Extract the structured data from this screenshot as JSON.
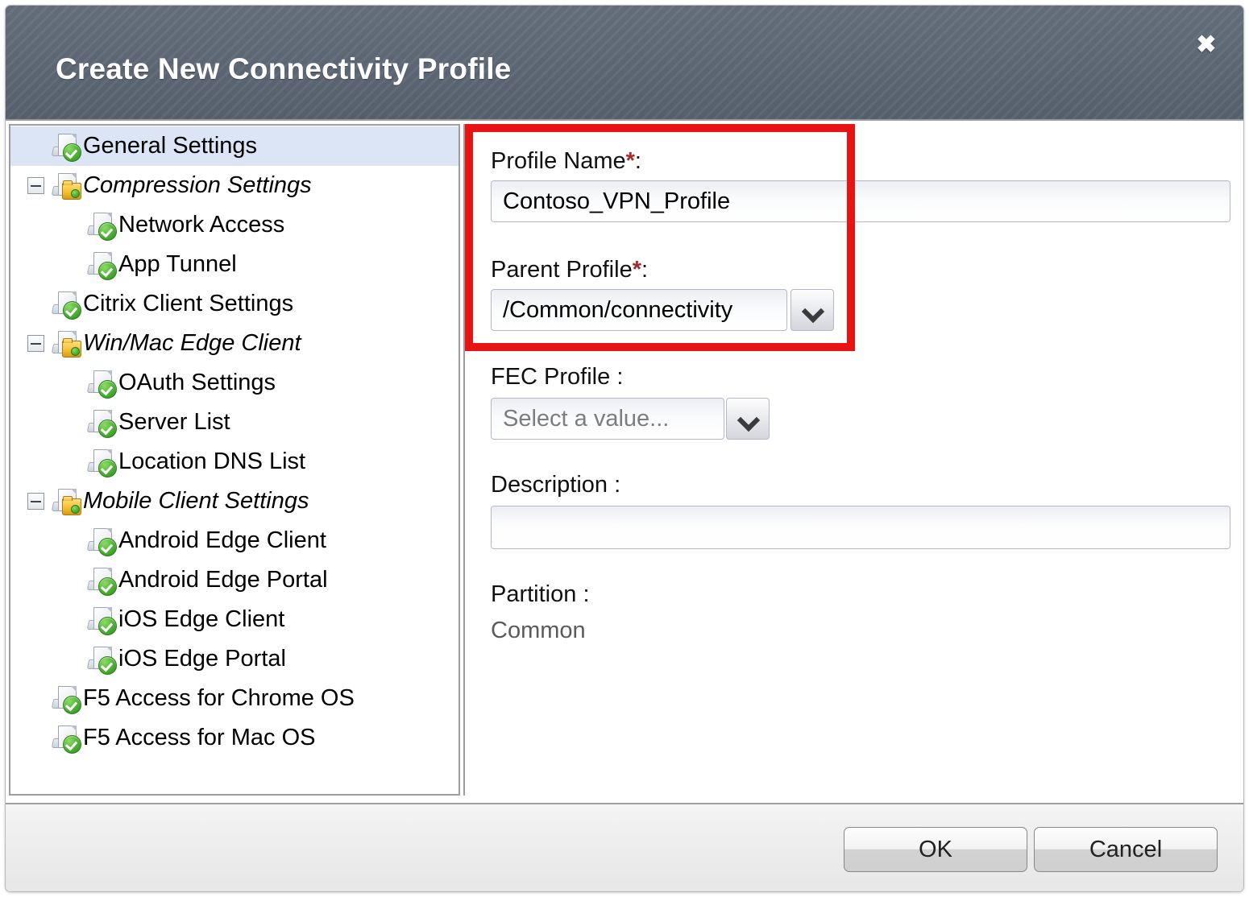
{
  "dialog": {
    "title": "Create New Connectivity Profile",
    "close_icon": "close-icon",
    "close_glyph": "✖"
  },
  "tree": {
    "items": [
      {
        "label": "General Settings",
        "level": 0,
        "selected": true,
        "expandable": false,
        "icon": "page-check-icon",
        "italic": false
      },
      {
        "label": "Compression Settings",
        "level": 0,
        "selected": false,
        "expandable": true,
        "icon": "page-folder-icon",
        "italic": true
      },
      {
        "label": "Network Access",
        "level": 1,
        "selected": false,
        "expandable": false,
        "icon": "page-check-icon",
        "italic": false
      },
      {
        "label": "App Tunnel",
        "level": 1,
        "selected": false,
        "expandable": false,
        "icon": "page-check-icon",
        "italic": false
      },
      {
        "label": "Citrix Client Settings",
        "level": 0,
        "selected": false,
        "expandable": false,
        "icon": "page-check-icon",
        "italic": false
      },
      {
        "label": "Win/Mac Edge Client",
        "level": 0,
        "selected": false,
        "expandable": true,
        "icon": "page-folder-icon",
        "italic": false
      },
      {
        "label": "OAuth Settings",
        "level": 1,
        "selected": false,
        "expandable": false,
        "icon": "page-check-icon",
        "italic": false
      },
      {
        "label": "Server List",
        "level": 1,
        "selected": false,
        "expandable": false,
        "icon": "page-check-icon",
        "italic": false
      },
      {
        "label": "Location DNS List",
        "level": 1,
        "selected": false,
        "expandable": false,
        "icon": "page-check-icon",
        "italic": false
      },
      {
        "label": "Mobile Client Settings",
        "level": 0,
        "selected": false,
        "expandable": true,
        "icon": "page-folder-icon",
        "italic": true
      },
      {
        "label": "Android Edge Client",
        "level": 1,
        "selected": false,
        "expandable": false,
        "icon": "page-check-icon",
        "italic": false
      },
      {
        "label": "Android Edge Portal",
        "level": 1,
        "selected": false,
        "expandable": false,
        "icon": "page-check-icon",
        "italic": false
      },
      {
        "label": "iOS Edge Client",
        "level": 1,
        "selected": false,
        "expandable": false,
        "icon": "page-check-icon",
        "italic": false
      },
      {
        "label": "iOS Edge Portal",
        "level": 1,
        "selected": false,
        "expandable": false,
        "icon": "page-check-icon",
        "italic": false
      },
      {
        "label": "F5 Access for Chrome OS",
        "level": 0,
        "selected": false,
        "expandable": false,
        "icon": "page-check-icon",
        "italic": false
      },
      {
        "label": "F5 Access for Mac OS",
        "level": 0,
        "selected": false,
        "expandable": false,
        "icon": "page-check-icon",
        "italic": false
      }
    ]
  },
  "form": {
    "profile_name": {
      "label": "Profile Name",
      "required_marker": "*",
      "colon": ":",
      "value": "Contoso_VPN_Profile"
    },
    "parent_profile": {
      "label": "Parent Profile",
      "required_marker": "*",
      "colon": ":",
      "value": "/Common/connectivity",
      "dropdown_icon": "chevron-down-icon"
    },
    "fec_profile": {
      "label": "FEC Profile :",
      "placeholder": "Select a value...",
      "value": "Select a value...",
      "dropdown_icon": "chevron-down-icon"
    },
    "description": {
      "label": "Description :",
      "value": ""
    },
    "partition": {
      "label": "Partition :",
      "value": "Common"
    }
  },
  "footer": {
    "ok_label": "OK",
    "cancel_label": "Cancel"
  },
  "colors": {
    "titlebar": "#5c6673",
    "selection": "#dbe5f5",
    "highlight_box": "#e81313",
    "required_star": "#a32b2b"
  }
}
